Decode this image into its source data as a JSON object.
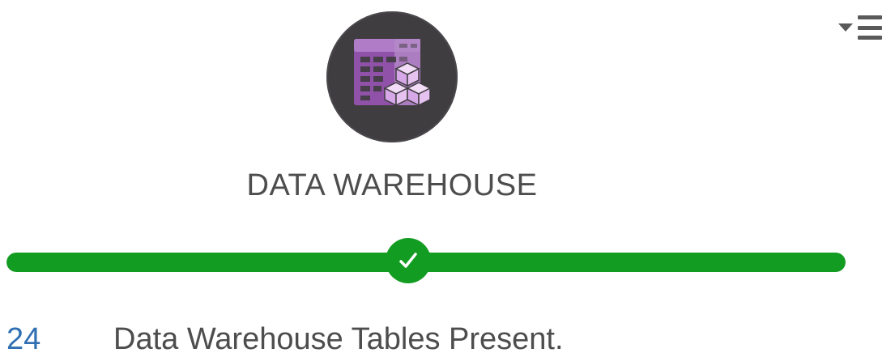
{
  "menu": {
    "icon": "caret-hamburger-menu-icon"
  },
  "card": {
    "icon": "data-warehouse-icon",
    "title": "DATA WAREHOUSE",
    "status": {
      "progress_fraction": 1.0,
      "icon": "checkmark-icon",
      "color": "#139c22"
    },
    "count": "24",
    "description": "Data Warehouse Tables Present."
  },
  "colors": {
    "icon_bg": "#3f3d40",
    "accent_purple": "#b07cc8",
    "count_link": "#2f6fb2",
    "text": "#4d4d4d"
  }
}
